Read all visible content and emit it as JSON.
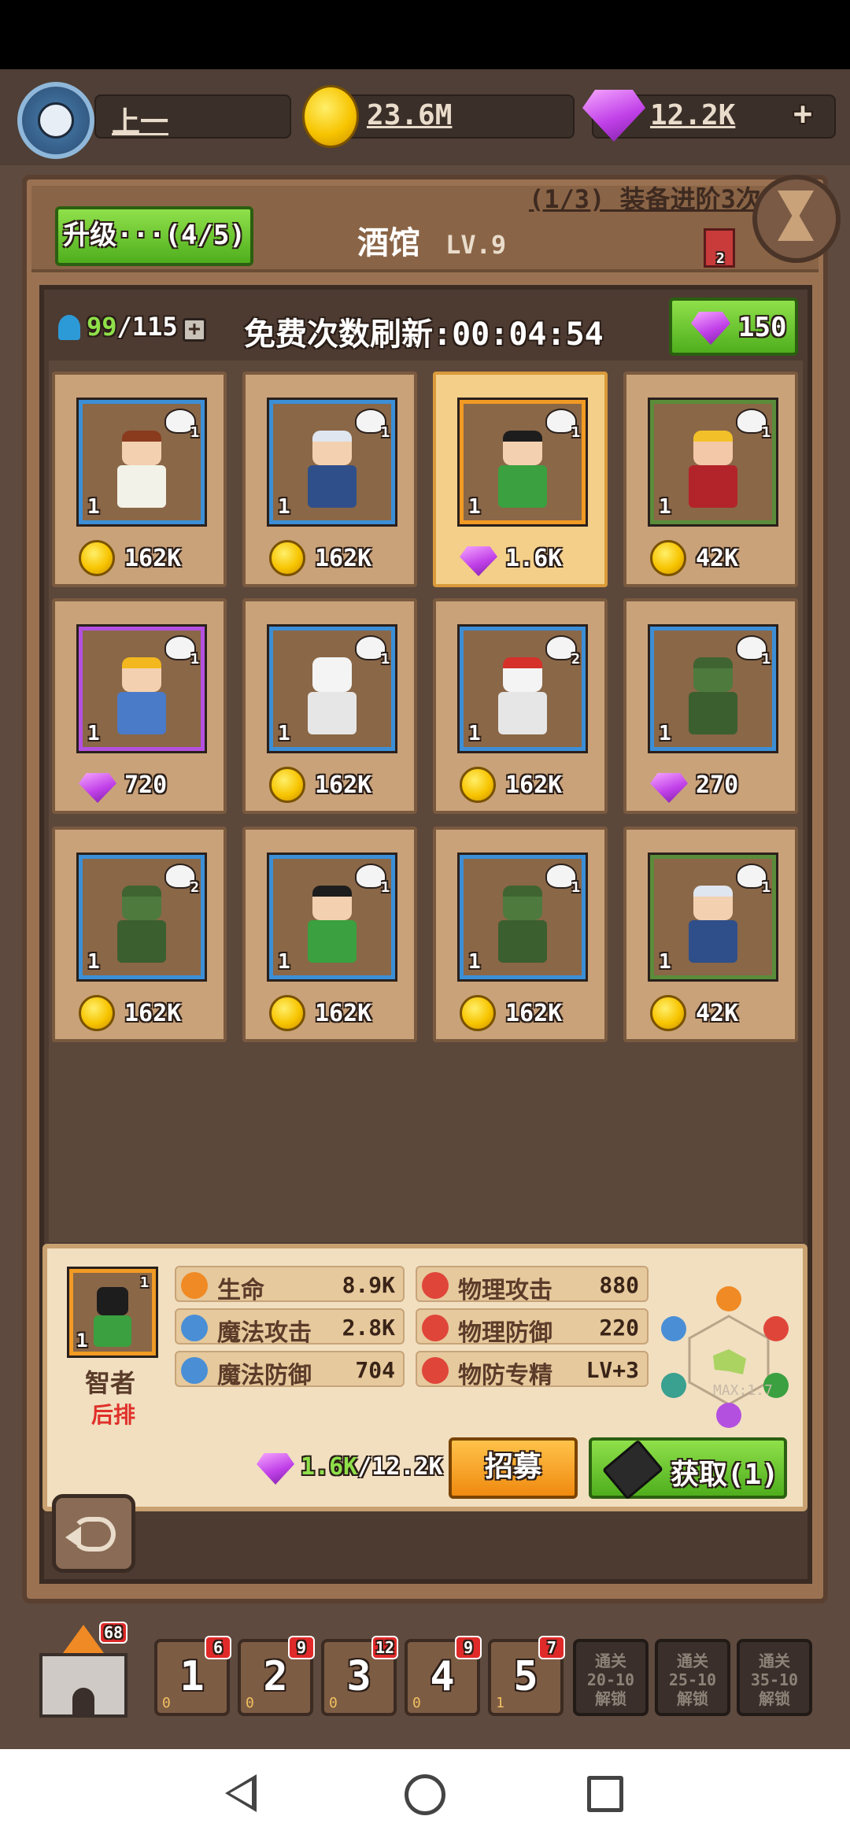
{
  "top": {
    "player_name": "上一",
    "gold": "23.6M",
    "gems": "12.2K",
    "plus_symbol": "+"
  },
  "header": {
    "upgrade_label": "升级···(4/5)",
    "title": "酒馆",
    "level": "LV.9",
    "equip_quest": "(1/3) 装备进阶3次",
    "flag_count": "2"
  },
  "shop": {
    "capacity_current": "99",
    "capacity_max": "/115",
    "refresh_label": "免费次数刷新:",
    "refresh_timer": "00:04:54",
    "refresh_cost": "150"
  },
  "cards": [
    {
      "level": "1",
      "role_count": "1",
      "currency": "gold",
      "price": "162K",
      "skin": "#f3d0b0",
      "hair": "#8a3b1e",
      "cloth": "#f2f2e8"
    },
    {
      "level": "1",
      "role_count": "1",
      "currency": "gold",
      "price": "162K",
      "skin": "#f3d0b0",
      "hair": "#dfe6ef",
      "cloth": "#2f4f8a"
    },
    {
      "level": "1",
      "role_count": "1",
      "currency": "gem",
      "price": "1.6K",
      "skin": "#f3d0b0",
      "hair": "#1d1d1d",
      "cloth": "#3aa040"
    },
    {
      "level": "1",
      "role_count": "1",
      "currency": "gold",
      "price": "42K",
      "skin": "#f3c8a8",
      "hair": "#f2c12a",
      "cloth": "#b3242a"
    },
    {
      "level": "1",
      "role_count": "1",
      "currency": "gem",
      "price": "720",
      "skin": "#f3d0b0",
      "hair": "#f2b81e",
      "cloth": "#4a7bc9"
    },
    {
      "level": "1",
      "role_count": "1",
      "currency": "gold",
      "price": "162K",
      "skin": "#f4f4f4",
      "hair": "#f4f4f4",
      "cloth": "#e6e6e6"
    },
    {
      "level": "1",
      "role_count": "2",
      "currency": "gold",
      "price": "162K",
      "skin": "#f4f4f4",
      "hair": "#d6302a",
      "cloth": "#e6e6e6"
    },
    {
      "level": "1",
      "role_count": "1",
      "currency": "gem",
      "price": "270",
      "skin": "#4f7a3e",
      "hair": "#3f6431",
      "cloth": "#3c5f30"
    },
    {
      "level": "1",
      "role_count": "2",
      "currency": "gold",
      "price": "162K",
      "skin": "#4f7a3e",
      "hair": "#3f6431",
      "cloth": "#3c5f30"
    },
    {
      "level": "1",
      "role_count": "1",
      "currency": "gold",
      "price": "162K",
      "skin": "#f3d0b0",
      "hair": "#1d1d1d",
      "cloth": "#3aa040"
    },
    {
      "level": "1",
      "role_count": "1",
      "currency": "gold",
      "price": "162K",
      "skin": "#4f7a3e",
      "hair": "#3f6431",
      "cloth": "#3c5f30"
    },
    {
      "level": "1",
      "role_count": "1",
      "currency": "gold",
      "price": "42K",
      "skin": "#f3d0b0",
      "hair": "#dfe6ef",
      "cloth": "#2f4f8a"
    }
  ],
  "detail": {
    "hero_name": "智者",
    "position": "后排",
    "level": "1",
    "role_count": "1",
    "stats": [
      {
        "name": "生命",
        "value": "8.9K",
        "color": "#f08a24"
      },
      {
        "name": "物理攻击",
        "value": "880",
        "color": "#e0453a"
      },
      {
        "name": "魔法攻击",
        "value": "2.8K",
        "color": "#4a8fd6"
      },
      {
        "name": "物理防御",
        "value": "220",
        "color": "#e0453a"
      },
      {
        "name": "魔法防御",
        "value": "704",
        "color": "#4a8fd6"
      },
      {
        "name": "物防专精",
        "value": "LV+3",
        "color": "#e0453a"
      }
    ],
    "radar_label": "MAX:1.7",
    "cost_current": "1.6K",
    "cost_total": "/12.2K",
    "recruit_label": "招募",
    "obtain_label": "获取(1)"
  },
  "bottom": {
    "castle_badge": "68",
    "slots": [
      {
        "num": "1",
        "badge": "6",
        "sub": "0"
      },
      {
        "num": "2",
        "badge": "9",
        "sub": "0"
      },
      {
        "num": "3",
        "badge": "12",
        "sub": "0"
      },
      {
        "num": "4",
        "badge": "9",
        "sub": "0"
      },
      {
        "num": "5",
        "badge": "7",
        "sub": "1"
      }
    ],
    "locked": [
      {
        "l1": "通关",
        "l2": "20-10",
        "l3": "解锁"
      },
      {
        "l1": "通关",
        "l2": "25-10",
        "l3": "解锁"
      },
      {
        "l1": "通关",
        "l2": "35-10",
        "l3": "解锁"
      }
    ]
  },
  "colors": {
    "frame": "#9a7252",
    "accent_green": "#4fae1d",
    "accent_orange": "#f08a10",
    "gem_purple": "#c040e8"
  }
}
